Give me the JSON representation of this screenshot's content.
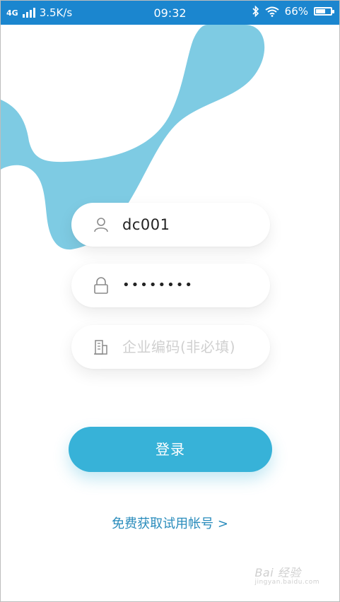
{
  "status_bar": {
    "network": "4G",
    "speed": "3.5K/s",
    "time": "09:32",
    "battery": "66%",
    "battery_level": 0.66
  },
  "form": {
    "username": "dc001",
    "password_mask": "••••••••",
    "company_placeholder": "企业编码(非必填)"
  },
  "actions": {
    "login_label": "登录",
    "trial_link": "免费获取试用帐号 >"
  },
  "watermark": {
    "text": "Bai 经验",
    "sub": "jingyan.baidu.com"
  },
  "colors": {
    "status_bar": "#1b86cf",
    "accent": "#37b2d8",
    "blob": "#7ecbe3",
    "link": "#2a8cbc"
  }
}
